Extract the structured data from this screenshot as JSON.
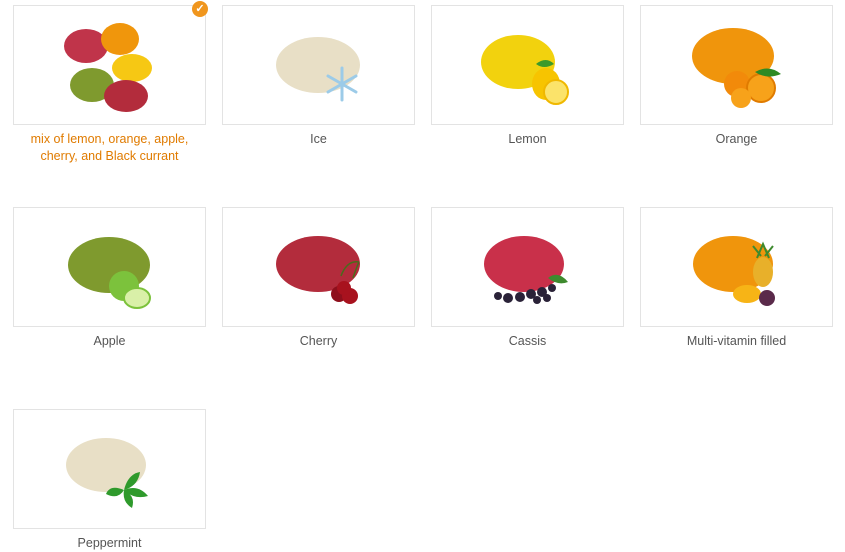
{
  "colors": {
    "accent": "#f0961e",
    "selected_label": "#e07b00",
    "label": "#555555",
    "border": "#e3e3e3"
  },
  "options": [
    {
      "label": "mix of lemon, orange, apple, cherry, and Black currant",
      "selected": true,
      "icon": "mixed-candies-icon"
    },
    {
      "label": "Ice",
      "selected": false,
      "icon": "snowflake-icon"
    },
    {
      "label": "Lemon",
      "selected": false,
      "icon": "lemon-icon"
    },
    {
      "label": "Orange",
      "selected": false,
      "icon": "orange-icon"
    },
    {
      "label": "Apple",
      "selected": false,
      "icon": "apple-icon"
    },
    {
      "label": "Cherry",
      "selected": false,
      "icon": "cherry-icon"
    },
    {
      "label": "Cassis",
      "selected": false,
      "icon": "blackcurrant-icon"
    },
    {
      "label": "Multi-vitamin filled",
      "selected": false,
      "icon": "tropical-fruit-icon"
    },
    {
      "label": "Peppermint",
      "selected": false,
      "icon": "mint-leaf-icon"
    }
  ]
}
